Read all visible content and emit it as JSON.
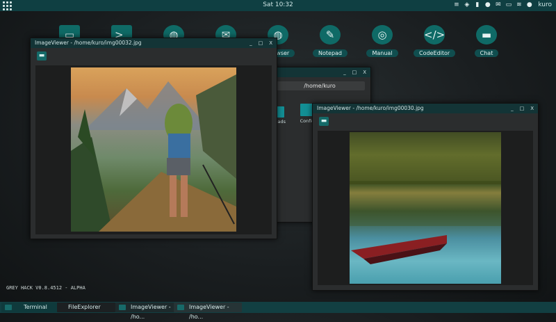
{
  "topbar": {
    "clock": "Sat 10:32",
    "user": "kuro"
  },
  "desktop_icons": [
    {
      "name": "Browser",
      "label": "Browser",
      "icon": "globe-icon"
    },
    {
      "name": "Notepad",
      "label": "Notepad",
      "icon": "notepad-icon"
    },
    {
      "name": "Manual",
      "label": "Manual",
      "icon": "lifebuoy-icon"
    },
    {
      "name": "CodeEditor",
      "label": "CodeEditor",
      "icon": "code-icon"
    },
    {
      "name": "Chat",
      "label": "Chat",
      "icon": "chat-icon"
    }
  ],
  "file_explorer": {
    "path": "/home/kuro",
    "items": [
      "Downloads",
      "Config"
    ]
  },
  "image_viewer_1": {
    "title": "ImageViewer - /home/kuro/img00032.jpg"
  },
  "image_viewer_2": {
    "title": "ImageViewer - /home/kuro/img00030.jpg"
  },
  "window_controls": {
    "minimize": "_",
    "maximize": "□",
    "close": "X"
  },
  "version": "GREY HACK V0.8.4512 - ALPHA",
  "taskbar": [
    {
      "label": "Terminal"
    },
    {
      "label": "FileExplorer"
    },
    {
      "label": "ImageViewer - /ho..."
    },
    {
      "label": "ImageViewer - /ho..."
    }
  ]
}
